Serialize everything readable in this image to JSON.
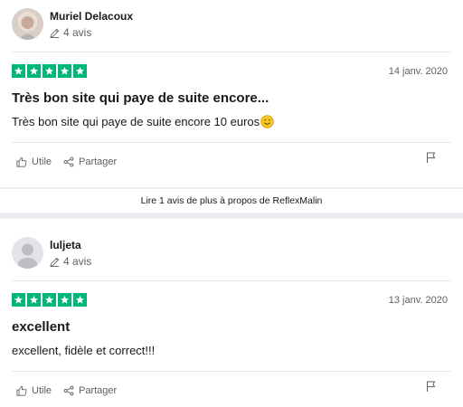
{
  "colors": {
    "star_green": "#00b67a",
    "text": "#191919",
    "muted": "#5f5f5f",
    "divider": "#e8e8e8",
    "band": "#ececf0"
  },
  "reviews": [
    {
      "author": "Muriel Delacoux",
      "review_count": "4 avis",
      "rating": 5,
      "date": "14 janv. 2020",
      "title": "Très bon site qui paye de suite encore...",
      "body": "Très bon site qui paye de suite encore 10 euros",
      "useful_label": "Utile",
      "share_label": "Partager",
      "avatar_icon": "profile-photo",
      "body_emoji_icon": "smiling-face-icon"
    },
    {
      "author": "luljeta",
      "review_count": "4 avis",
      "rating": 5,
      "date": "13 janv. 2020",
      "title": "excellent",
      "body": "excellent, fidèle et correct!!!",
      "useful_label": "Utile",
      "share_label": "Partager",
      "avatar_icon": "default-user-icon"
    }
  ],
  "more_link": "Lire 1 avis de plus à propos de ReflexMalin"
}
